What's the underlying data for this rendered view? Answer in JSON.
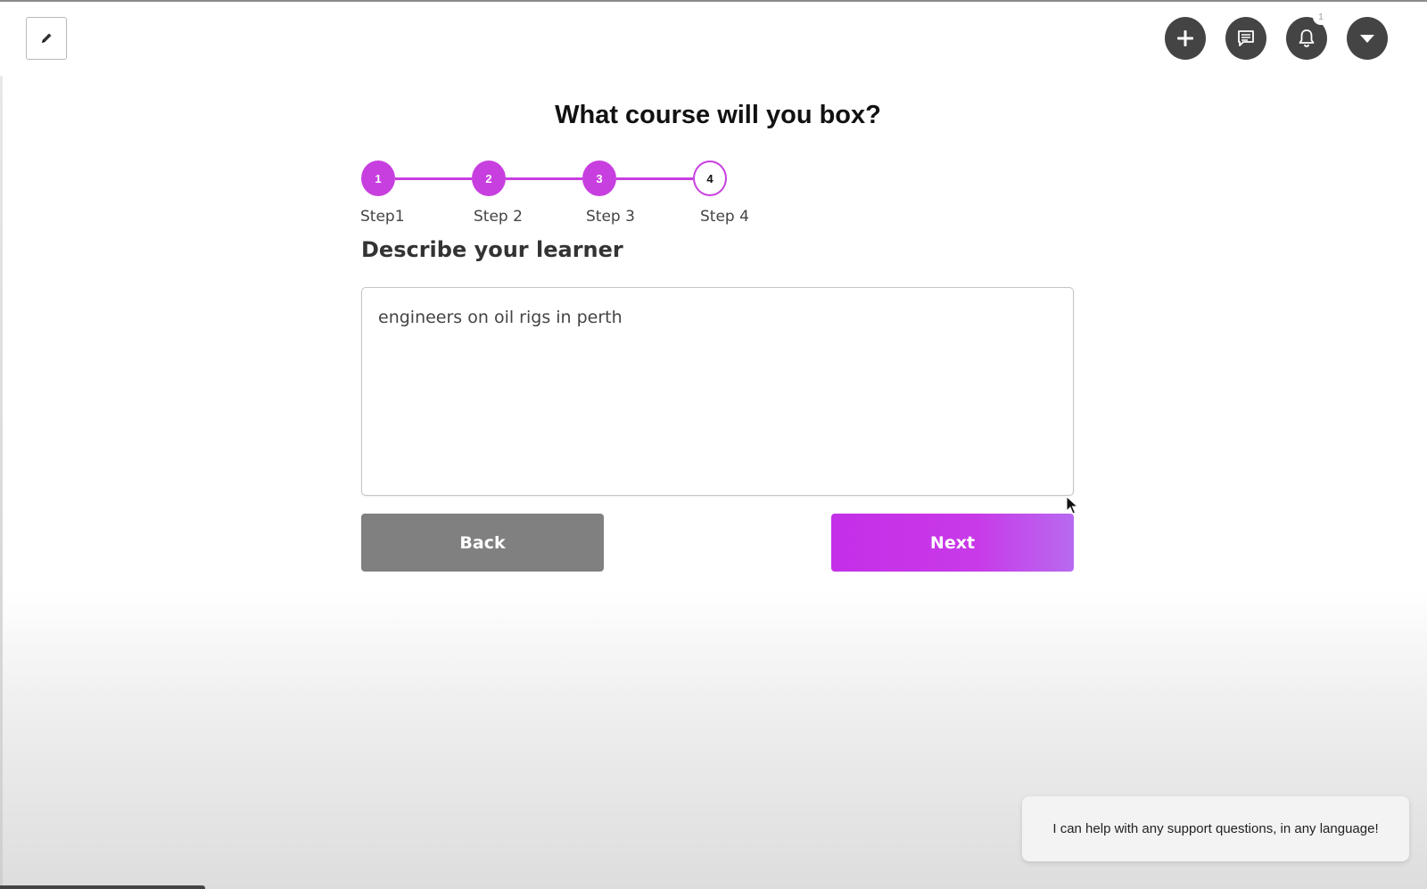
{
  "header": {
    "edit_icon": "pencil-icon",
    "actions": [
      {
        "name": "add-button",
        "icon": "plus-icon"
      },
      {
        "name": "messages-button",
        "icon": "chat-icon"
      },
      {
        "name": "notifications-button",
        "icon": "bell-icon",
        "badge": "1"
      },
      {
        "name": "account-menu-button",
        "icon": "caret-down-icon"
      }
    ]
  },
  "wizard": {
    "title": "What course will you box?",
    "steps": [
      {
        "number": "1",
        "label": "Step1",
        "state": "complete"
      },
      {
        "number": "2",
        "label": "Step 2",
        "state": "complete"
      },
      {
        "number": "3",
        "label": "Step 3",
        "state": "complete"
      },
      {
        "number": "4",
        "label": "Step 4",
        "state": "current"
      }
    ],
    "section_title": "Describe your learner",
    "learner_value": "engineers on oil rigs in perth",
    "back_label": "Back",
    "next_label": "Next"
  },
  "support": {
    "message": "I can help with any support questions, in any language!"
  },
  "colors": {
    "accent": "#c83fe0",
    "icon_button_bg": "#444444",
    "back_button": "#808080"
  }
}
